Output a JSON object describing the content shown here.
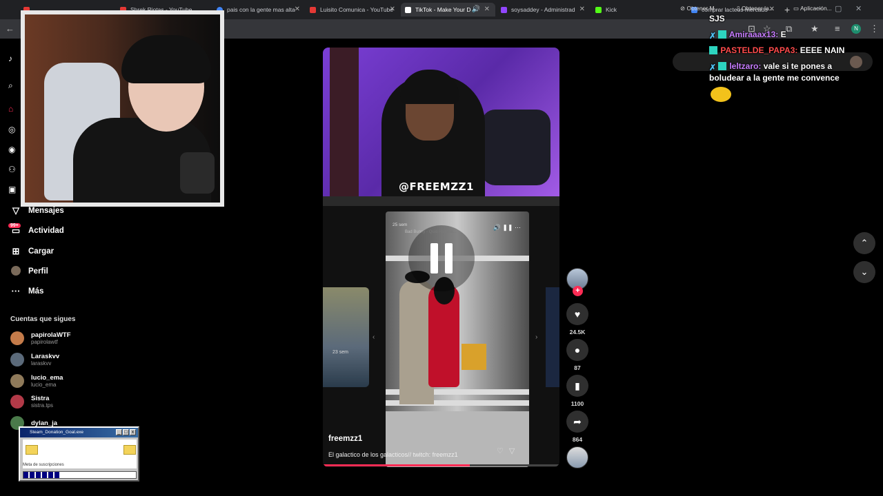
{
  "browser": {
    "tabs": [
      {
        "label": "...",
        "color": "#e53935"
      },
      {
        "label": "Shrek Riotas - YouTube",
        "color": "#e53935"
      },
      {
        "label": "pais con la gente mas alta",
        "color": "#4285f4"
      },
      {
        "label": "Luisito Comunica - YouTube",
        "color": "#e53935"
      },
      {
        "label": "TikTok - Make Your D",
        "color": "#111111",
        "active": true
      },
      {
        "label": "soysaddey - Administrad",
        "color": "#9146ff"
      },
      {
        "label": "Kick",
        "color": "#53fc18"
      },
      {
        "label": "comprar lacteos mercado",
        "color": "#4285f4"
      }
    ],
    "new_tab": "+",
    "profile_initial": "N"
  },
  "tiktok": {
    "logo": "TikTok",
    "nav": [
      {
        "label": "Mensajes",
        "icon": "send-icon"
      },
      {
        "label": "Actividad",
        "icon": "inbox-icon",
        "badge": "99+"
      },
      {
        "label": "Cargar",
        "icon": "plus-square-icon"
      },
      {
        "label": "Perfil",
        "icon": "avatar"
      },
      {
        "label": "Más",
        "icon": "more-icon"
      }
    ],
    "following_title": "Cuentas que sigues",
    "following": [
      {
        "name": "papirolaWTF",
        "handle": "papirolawtf",
        "color": "#c47b4a"
      },
      {
        "name": "Laraskvv",
        "handle": "laraskvv",
        "color": "#5b6a7a"
      },
      {
        "name": "lucio_ema",
        "handle": "lucio_ema",
        "color": "#8f7a5a"
      },
      {
        "name": "Sistra",
        "handle": "sistra.tps",
        "color": "#b23a48"
      },
      {
        "name": "dylan_ja",
        "handle": "",
        "color": "#4a7a4a"
      }
    ],
    "top_pills": [
      "Obtener M...",
      "Obtener la...",
      "Aplicación..."
    ],
    "video": {
      "streamer_handle": "@FREEMZZ1",
      "post_age": "25 sem",
      "post_sound": "Bad Bunny - Quiá Pasaría...",
      "left_thumb_date": "23 sem",
      "author": "freemzz1",
      "caption": "El galactico de los galacticos// twitch: freemzz1",
      "progress": 0.62
    },
    "actions": [
      {
        "icon": "heart-icon",
        "count": "24.5K"
      },
      {
        "icon": "comment-icon",
        "count": "87"
      },
      {
        "icon": "bookmark-icon",
        "count": "1100"
      },
      {
        "icon": "share-icon",
        "count": "864"
      }
    ]
  },
  "chat": [
    {
      "user": "",
      "text": "SJS",
      "user_color": "#ffffff"
    },
    {
      "user": "Amiraaax13:",
      "text": "E",
      "user_color": "#c77dff"
    },
    {
      "user": "PASTELDE_PAPA3:",
      "text": "EEEE NAIN",
      "user_color": "#ff4b4b"
    },
    {
      "user": "leltzaro:",
      "text": "vale si te pones a",
      "user_color": "#c77dff"
    },
    {
      "user": "",
      "text": "boludear a la gente me convence",
      "user_color": "#ffffff"
    }
  ],
  "donation_goal": {
    "title": "Steam_Donation_Goal.exe",
    "label": "Meta de suscripciones",
    "progress": 0.33
  }
}
